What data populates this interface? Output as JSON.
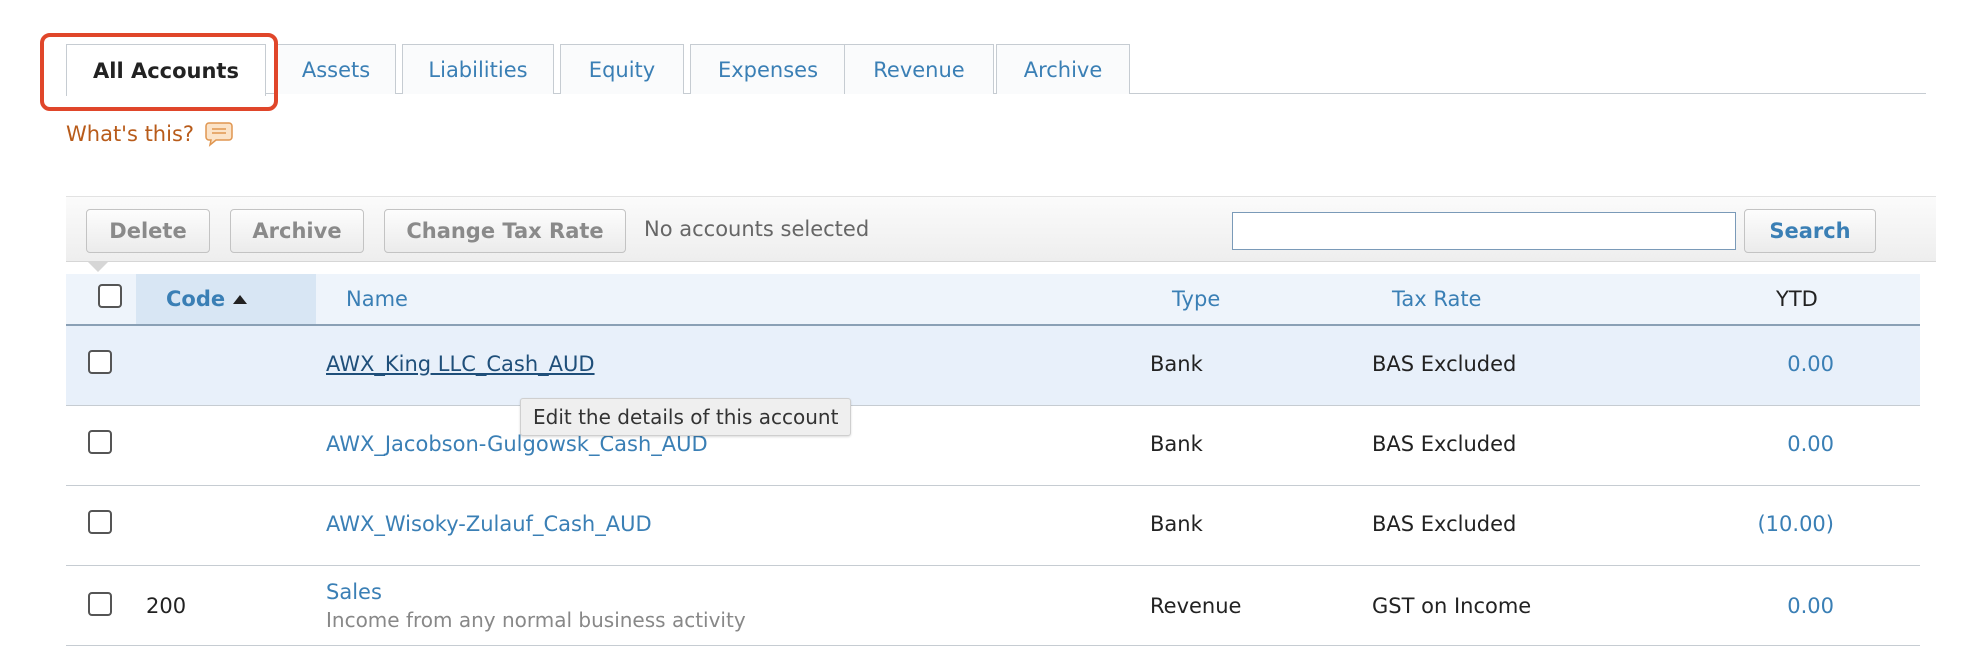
{
  "tabs": [
    {
      "label": "All Accounts",
      "active": true
    },
    {
      "label": "Assets"
    },
    {
      "label": "Liabilities"
    },
    {
      "label": "Equity"
    },
    {
      "label": "Expenses"
    },
    {
      "label": "Revenue"
    },
    {
      "label": "Archive"
    }
  ],
  "help": {
    "label": "What's this?",
    "icon": "speech-bubble-icon"
  },
  "toolbar": {
    "delete_label": "Delete",
    "archive_label": "Archive",
    "change_tax_label": "Change Tax Rate",
    "selection_status": "No accounts selected",
    "search_value": "",
    "search_label": "Search"
  },
  "table": {
    "headers": {
      "code": "Code",
      "name": "Name",
      "type": "Type",
      "tax_rate": "Tax Rate",
      "ytd": "YTD"
    },
    "rows": [
      {
        "code": "",
        "name": "AWX_King LLC_Cash_AUD",
        "description": "",
        "type": "Bank",
        "tax_rate": "BAS Excluded",
        "ytd": "0.00"
      },
      {
        "code": "",
        "name": "AWX_Jacobson-Gulgowsk_Cash_AUD",
        "description": "",
        "type": "Bank",
        "tax_rate": "BAS Excluded",
        "ytd": "0.00"
      },
      {
        "code": "",
        "name": "AWX_Wisoky-Zulauf_Cash_AUD",
        "description": "",
        "type": "Bank",
        "tax_rate": "BAS Excluded",
        "ytd": "(10.00)"
      },
      {
        "code": "200",
        "name": "Sales",
        "description": "Income from any normal business activity",
        "type": "Revenue",
        "tax_rate": "GST on Income",
        "ytd": "0.00"
      }
    ]
  },
  "tooltip": "Edit the details of this account",
  "colors": {
    "link": "#3a7fb5",
    "highlight": "#e0462a",
    "help": "#b85b1a"
  }
}
